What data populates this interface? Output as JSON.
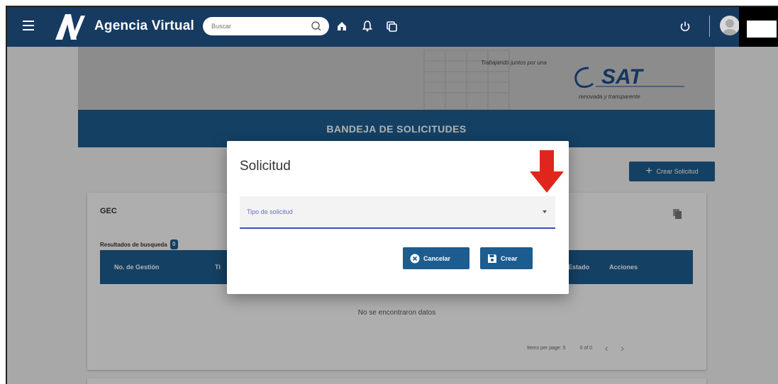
{
  "topbar": {
    "app_title": "Agencia Virtual",
    "search_placeholder": "Buscar",
    "icons": [
      "menu-icon",
      "home-icon",
      "bell-icon",
      "copy-icon",
      "power-icon",
      "user-avatar"
    ]
  },
  "banner": {
    "tagline": "Trabajando juntos por una",
    "logo_text": "SAT",
    "subtitle": "renovada y transparente"
  },
  "page": {
    "title": "BANDEJA DE SOLICITUDES",
    "create_button": "Crear Solicitud"
  },
  "card": {
    "title": "GEC",
    "results_label": "Resultados de busqueda",
    "results_count": "0",
    "columns": [
      "No. de Gestión",
      "Ti",
      "Estado",
      "Acciones"
    ],
    "empty_message": "No se encontraron datos",
    "pager": {
      "items_per_page": "Items per page: 5",
      "range": "0 of 0",
      "prev": "‹",
      "next": "›"
    }
  },
  "dialog": {
    "title": "Solicitud",
    "select_label": "Tipo de solicitud",
    "cancel_label": "Cancelar",
    "create_label": "Crear"
  },
  "colors": {
    "navbar": "#173a60",
    "primary": "#1d5c8f",
    "arrow": "#e0261c"
  }
}
